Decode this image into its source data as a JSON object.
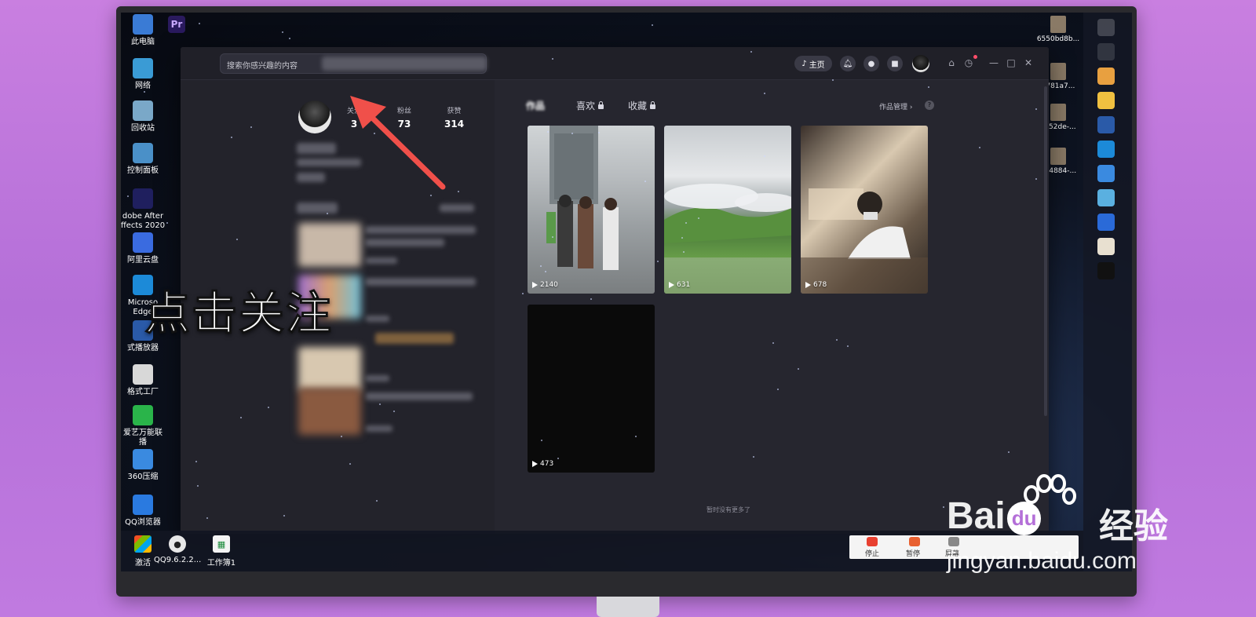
{
  "desktop": {
    "left_icons": [
      {
        "label": "此电脑",
        "icon": "computer-icon",
        "color": "#3a7bd5"
      },
      {
        "label": "网络",
        "icon": "network-icon",
        "color": "#3a9bd5"
      },
      {
        "label": "回收站",
        "icon": "recycle-bin-icon",
        "color": "#7aa8c8"
      },
      {
        "label": "控制面板",
        "icon": "control-panel-icon",
        "color": "#4a90c8"
      },
      {
        "label": "dobe After ffects 2020",
        "icon": "after-effects-icon",
        "color": "#1f1f5e"
      },
      {
        "label": "阿里云盘",
        "icon": "cloud-drive-icon",
        "color": "#3a6be0"
      },
      {
        "label": "Microso Edge",
        "icon": "edge-icon",
        "color": "#1c8ad8"
      },
      {
        "label": "式播放器",
        "icon": "player-icon",
        "color": "#2a5aa8"
      },
      {
        "label": "格式工厂",
        "icon": "format-factory-icon",
        "color": "#d8d8d8"
      },
      {
        "label": "爱艺万能联 播",
        "icon": "iqiyi-icon",
        "color": "#2ab44a"
      },
      {
        "label": "360压缩",
        "icon": "zip-icon",
        "color": "#3a8ae0"
      },
      {
        "label": "QQ浏览器",
        "icon": "qq-browser-icon",
        "color": "#2a7ae0"
      }
    ],
    "top_icons": [
      {
        "label": "Pr",
        "icon": "premiere-icon",
        "color": "#2a1a5e"
      }
    ],
    "right_files": [
      "6550bd8b...",
      "9781a7...",
      "dc52de-...",
      "364884-..."
    ],
    "taskbar": [
      {
        "label": "激活",
        "icon": "windows-start-icon"
      },
      {
        "label": "QQ9.6.2.2...",
        "icon": "qq-icon"
      },
      {
        "label": "工作簿1",
        "icon": "spreadsheet-icon"
      }
    ],
    "right_strip_icons": [
      "windows-logo-icon",
      "search-icon",
      "store-icon",
      "folder-icon",
      "photoshop-icon",
      "edge-icon",
      "browser-icon",
      "cube-icon",
      "search-app-icon",
      "image-icon",
      "tiktok-icon"
    ]
  },
  "app": {
    "search_placeholder": "搜索你感兴趣的内容",
    "home_label": "主页",
    "profile": {
      "stats": [
        {
          "label": "关注",
          "value": "3"
        },
        {
          "label": "粉丝",
          "value": "73"
        },
        {
          "label": "获赞",
          "value": "314"
        }
      ]
    },
    "tabs": [
      {
        "label": "作品",
        "active": true
      },
      {
        "label": "喜欢",
        "locked": true
      },
      {
        "label": "收藏",
        "locked": true
      }
    ],
    "manage_label": "作品管理 ›",
    "help_label": "?",
    "videos": [
      {
        "plays": "2140"
      },
      {
        "plays": "631"
      },
      {
        "plays": "678"
      },
      {
        "plays": "473"
      }
    ],
    "no_more_text": "暂时没有更多了"
  },
  "overlay": {
    "caption": "点击关注"
  },
  "recorder": {
    "stop": "停止",
    "pause": "暂停",
    "screen": "屏幕"
  },
  "watermark": {
    "brand": "Bai",
    "brand2": "du",
    "cn": "经验",
    "url": "jingyan.baidu.com"
  }
}
